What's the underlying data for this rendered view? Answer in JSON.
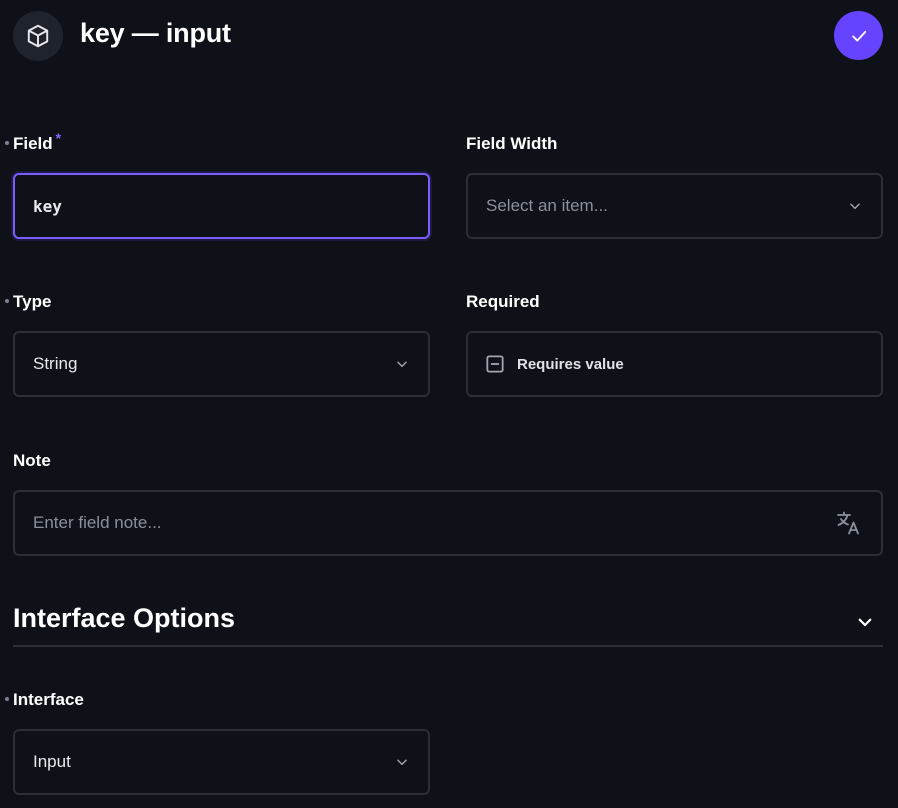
{
  "header": {
    "title": "key — input",
    "icon": "cube-icon",
    "save_icon": "check-icon",
    "accent_color": "#6644ff"
  },
  "fields": {
    "field": {
      "label": "Field",
      "required_marker": "*",
      "value": "key"
    },
    "field_width": {
      "label": "Field Width",
      "placeholder": "Select an item..."
    },
    "type": {
      "label": "Type",
      "value": "String"
    },
    "required": {
      "label": "Required",
      "checkbox_label": "Requires value"
    },
    "note": {
      "label": "Note",
      "placeholder": "Enter field note...",
      "icon": "translate-icon"
    }
  },
  "interface_options": {
    "title": "Interface Options",
    "interface": {
      "label": "Interface",
      "value": "Input"
    }
  }
}
